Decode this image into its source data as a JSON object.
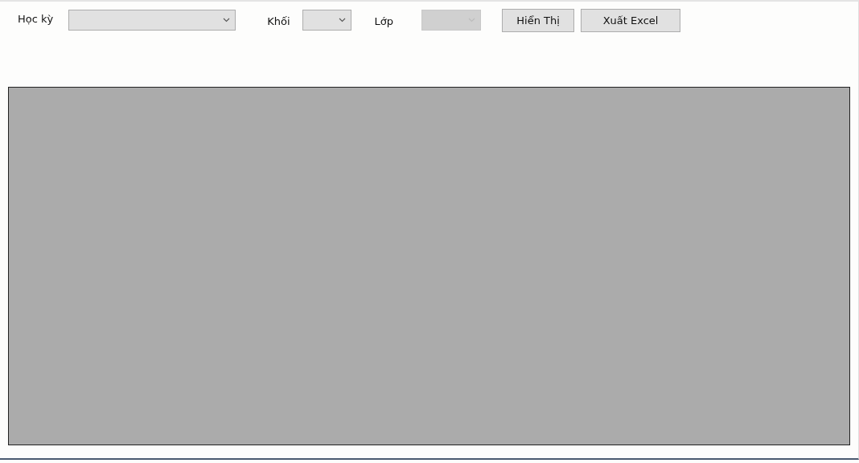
{
  "filters": [
    {
      "label": "Học kỳ",
      "disabled": false
    },
    {
      "label": "Khối",
      "disabled": false
    },
    {
      "label": "Lớp",
      "disabled": true
    }
  ],
  "buttons": [
    "Hiển Thị",
    "Xuất Excel"
  ]
}
